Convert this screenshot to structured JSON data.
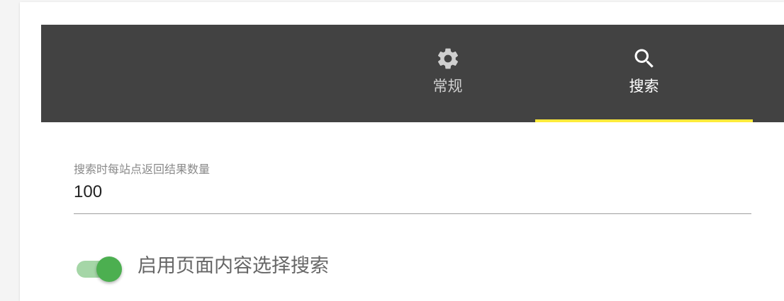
{
  "tabs": [
    {
      "label": "常规",
      "icon": "gear-icon",
      "active": false
    },
    {
      "label": "搜索",
      "icon": "search-icon",
      "active": true
    }
  ],
  "colors": {
    "tabbar_bg": "#424242",
    "indicator": "#ffeb3b",
    "switch_on": "#4caf50",
    "switch_track": "#a5d6a7"
  },
  "settings": {
    "results_per_site": {
      "label": "搜索时每站点返回结果数量",
      "value": "100"
    },
    "page_content_search": {
      "label": "启用页面内容选择搜索",
      "enabled": true
    }
  }
}
